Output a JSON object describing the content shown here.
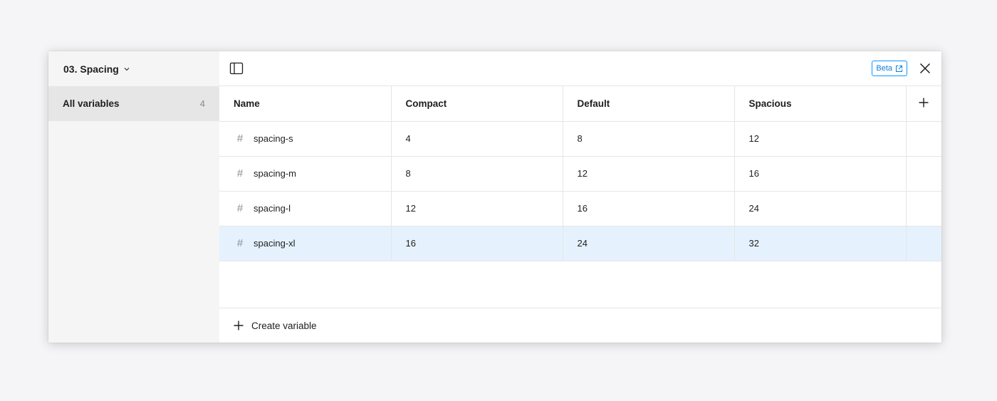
{
  "sidebar": {
    "collection_name": "03. Spacing",
    "items": [
      {
        "label": "All variables",
        "count": "4"
      }
    ]
  },
  "toolbar": {
    "beta_label": "Beta"
  },
  "table": {
    "columns": [
      "Name",
      "Compact",
      "Default",
      "Spacious"
    ],
    "rows": [
      {
        "name": "spacing-s",
        "values": [
          "4",
          "8",
          "12"
        ]
      },
      {
        "name": "spacing-m",
        "values": [
          "8",
          "12",
          "16"
        ]
      },
      {
        "name": "spacing-l",
        "values": [
          "12",
          "16",
          "24"
        ]
      },
      {
        "name": "spacing-xl",
        "values": [
          "16",
          "24",
          "32"
        ]
      }
    ],
    "type_icon": "hash-icon",
    "selected_row": 3
  },
  "footer": {
    "create_label": "Create variable"
  },
  "colors": {
    "accent": "#0d99ff",
    "selected_row_bg": "#e5f2fe",
    "sidebar_bg": "#f5f5f5",
    "sidebar_active_bg": "#e6e6e6"
  }
}
